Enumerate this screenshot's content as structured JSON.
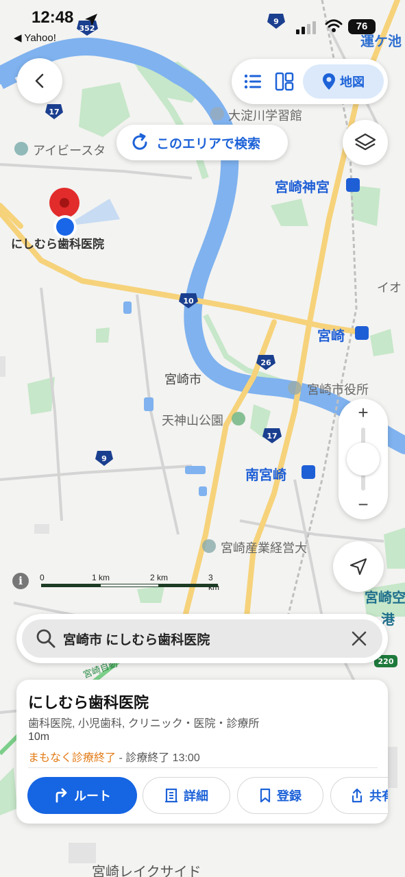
{
  "status_bar": {
    "time": "12:48",
    "back_app": "◀ Yahoo!",
    "battery": "76"
  },
  "toolbar": {
    "back_icon": "chevron-left-icon",
    "view_list_icon": "list-icon",
    "view_split_icon": "split-view-icon",
    "view_map_label": "地図"
  },
  "search_this_area": {
    "label": "このエリアで検索"
  },
  "map": {
    "route_shields": [
      "352",
      "9",
      "17",
      "10",
      "26",
      "17",
      "9",
      "220"
    ],
    "labels": {
      "osodogawa": "大淀川学習館",
      "ivy": "アイビースタ",
      "jingu": "宮崎神宮",
      "clinic": "にしむら歯科医院",
      "aeon": "イオ",
      "miyazaki_st": "宮崎",
      "city": "宮崎市",
      "cityhall": "宮崎市役所",
      "tenjinyama": "天神山公園",
      "minami": "南宮崎",
      "univ": "宮崎産業経営大",
      "airport1": "宮崎空",
      "airport2": "港",
      "lakeside": "宮崎レイクサイド",
      "unga": "運ケ池",
      "jidosha": "宮崎自動",
      "kyo": "共"
    },
    "colors": {
      "water": "#7fb2ef",
      "road_major": "#f6d27a",
      "green": "#bfe4c4",
      "pin": "#e22b2b",
      "location": "#1a66e8"
    }
  },
  "zoom": {
    "plus": "+",
    "minus": "−"
  },
  "scale": {
    "info": "i",
    "labels": [
      "0",
      "1 km",
      "2 km",
      "3 km"
    ]
  },
  "searchbar": {
    "value": "宮崎市 にしむら歯科医院",
    "clear_icon": "close-icon"
  },
  "place_card": {
    "title": "にしむら歯科医院",
    "categories": "歯科医院, 小児歯科, クリニック・医院・診療所",
    "distance": "10m",
    "status_warning": "まもなく診療終了",
    "status_detail": " - 診療終了 13:00",
    "buttons": {
      "route": "ルート",
      "detail": "詳細",
      "save": "登録",
      "share": "共有"
    }
  }
}
